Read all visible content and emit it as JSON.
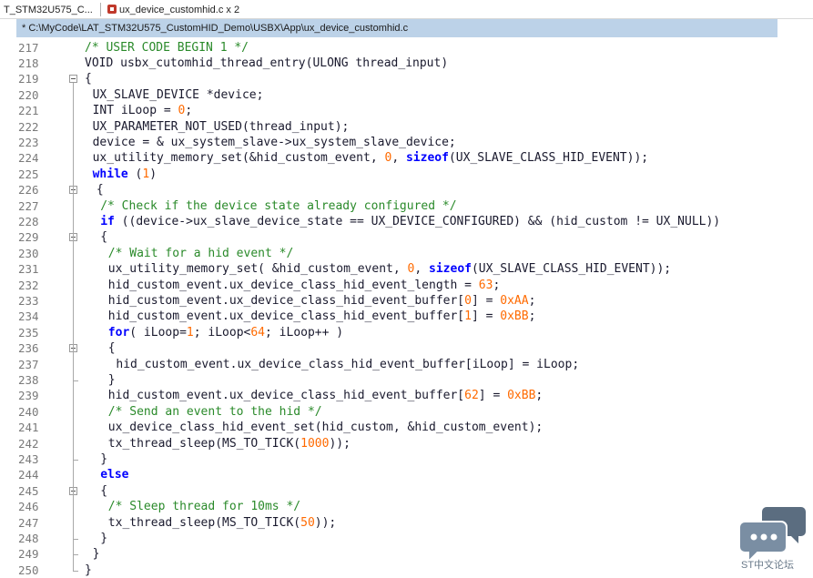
{
  "tabs": [
    {
      "label": "T_STM32U575_C..."
    },
    {
      "label": "ux_device_customhid.c x 2"
    }
  ],
  "path": "* C:\\MyCode\\LAT_STM32U575_CustomHID_Demo\\USBX\\App\\ux_device_customhid.c",
  "watermark_text": "ST中文论坛",
  "line_numbers": [
    "217",
    "218",
    "219",
    "220",
    "221",
    "222",
    "223",
    "224",
    "225",
    "226",
    "227",
    "228",
    "229",
    "230",
    "231",
    "232",
    "233",
    "234",
    "235",
    "236",
    "237",
    "238",
    "239",
    "240",
    "241",
    "242",
    "243",
    "244",
    "245",
    "246",
    "247",
    "248",
    "249",
    "250"
  ],
  "code_lines": [
    "/* USER CODE BEGIN 1 */",
    "VOID usbx_cutomhid_thread_entry(ULONG thread_input)",
    "{",
    "UX_SLAVE_DEVICE *device;",
    "INT iLoop = 0;",
    "UX_PARAMETER_NOT_USED(thread_input);",
    "device = & ux_system_slave->ux_system_slave_device;",
    "ux_utility_memory_set(&hid_custom_event, 0, sizeof(UX_SLAVE_CLASS_HID_EVENT));",
    "while (1)",
    "{",
    "/* Check if the device state already configured */",
    "if ((device->ux_slave_device_state == UX_DEVICE_CONFIGURED) && (hid_custom != UX_NULL))",
    "{",
    "/* Wait for a hid event */",
    "ux_utility_memory_set( &hid_custom_event, 0, sizeof(UX_SLAVE_CLASS_HID_EVENT));",
    "hid_custom_event.ux_device_class_hid_event_length = 63;",
    "hid_custom_event.ux_device_class_hid_event_buffer[0] = 0xAA;",
    "hid_custom_event.ux_device_class_hid_event_buffer[1] = 0xBB;",
    "for( iLoop=1; iLoop<64; iLoop++ )",
    "{",
    "hid_custom_event.ux_device_class_hid_event_buffer[iLoop] = iLoop;",
    "}",
    "hid_custom_event.ux_device_class_hid_event_buffer[62] = 0xBB;",
    "/* Send an event to the hid */",
    "ux_device_class_hid_event_set(hid_custom, &hid_custom_event);",
    "tx_thread_sleep(MS_TO_TICK(1000));",
    "}",
    "else",
    "{",
    "/* Sleep thread for 10ms */",
    "tx_thread_sleep(MS_TO_TICK(50));",
    "}",
    "}",
    "}"
  ]
}
